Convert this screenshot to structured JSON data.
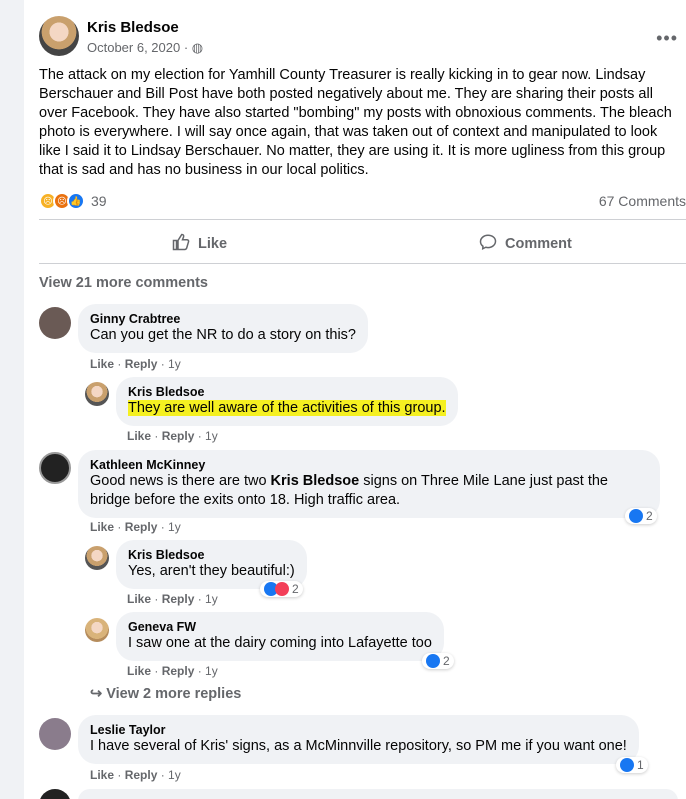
{
  "post": {
    "author": "Kris Bledsoe",
    "date": "October 6, 2020",
    "privacy_icon": "globe-icon",
    "text": "The attack on my election for Yamhill County Treasurer is really kicking in to gear now. Lindsay Berschauer and Bill Post have both posted negatively about me. They are sharing their posts  all over Facebook. They have also started \"bombing\" my posts with obnoxious comments. The bleach photo is everywhere. I will say once again, that was taken out of context and manipulated to look like I said it to Lindsay Berschauer. No matter, they are using it. It is more ugliness from this group that is sad and has no business in our local politics.",
    "reactions_count": "39",
    "comments_count": "67 Comments",
    "reaction_icons": [
      "sad-icon",
      "angry-icon",
      "like-icon"
    ]
  },
  "actions": {
    "like": "Like",
    "comment": "Comment"
  },
  "view_more_comments": "View 21 more comments",
  "comments": [
    {
      "name": "Ginny Crabtree",
      "text": "Can you get the NR to do a story on this?",
      "like": "Like",
      "reply": "Reply",
      "time": "1y"
    },
    {
      "name": "Kris Bledsoe",
      "text": "They are well aware of the activities of this group.",
      "like": "Like",
      "reply": "Reply",
      "time": "1y"
    },
    {
      "name": "Kathleen McKinney",
      "text_pre": "Good news is there are two ",
      "text_bold": "Kris Bledsoe",
      "text_post": " signs on Three Mile Lane just past the bridge before the exits onto 18. High traffic area.",
      "like": "Like",
      "reply": "Reply",
      "time": "1y",
      "reactions": "2"
    },
    {
      "name": "Kris Bledsoe",
      "text": "Yes, aren't they beautiful:)",
      "like": "Like",
      "reply": "Reply",
      "time": "1y",
      "reactions": "2"
    },
    {
      "name": "Geneva FW",
      "text": "I saw one at the dairy coming into Lafayette too",
      "like": "Like",
      "reply": "Reply",
      "time": "1y",
      "reactions": "2"
    },
    {
      "name": "Leslie Taylor",
      "text": "I have several of Kris' signs, as a McMinnville repository, so PM me if you want one!",
      "like": "Like",
      "reply": "Reply",
      "time": "1y",
      "reactions": "1"
    }
  ],
  "view_more_replies": "View 2 more replies",
  "colors": {
    "like_blue": "#1877f2",
    "highlight": "#f5f021",
    "secondary_text": "#65676b"
  }
}
